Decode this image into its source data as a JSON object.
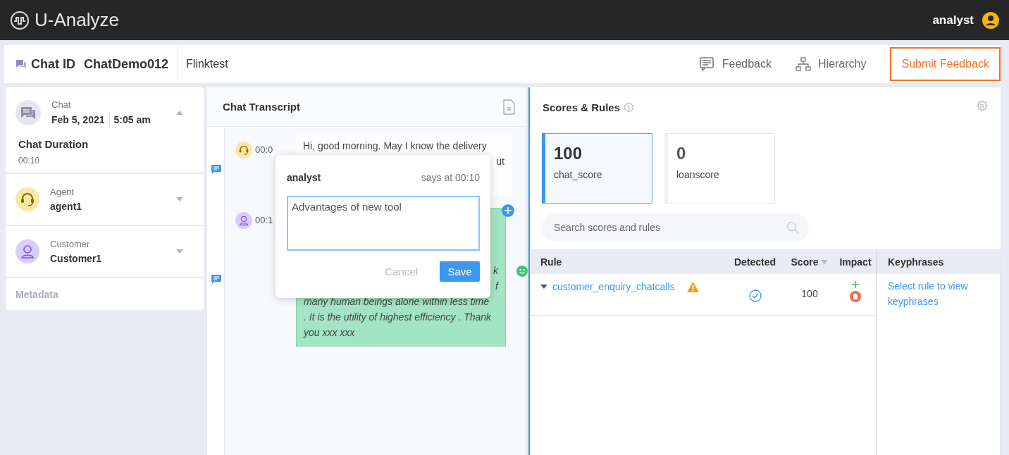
{
  "app": {
    "title": "U-Analyze",
    "user": "analyst"
  },
  "header": {
    "chat_id_label": "Chat ID",
    "chat_id": "ChatDemo012",
    "tag": "Flinktest",
    "actions": [
      {
        "label": "Feedback",
        "kind": "feedback"
      },
      {
        "label": "Hierarchy",
        "kind": "hierarchy"
      }
    ],
    "submit": "Submit Feedback"
  },
  "sidebar": {
    "chat": {
      "label": "Chat",
      "date": "Feb 5, 2021",
      "time": "5:05 am",
      "expanded": true,
      "duration_label": "Chat Duration",
      "duration": "00:10"
    },
    "participants": [
      {
        "kind": "agent",
        "role": "Agent",
        "name": "agent1",
        "expanded": false
      },
      {
        "kind": "customer",
        "role": "Customer",
        "name": "Customer1",
        "expanded": false
      }
    ],
    "metadata": {
      "label": "Metadata",
      "disabled": true
    }
  },
  "transcript": {
    "title": "Chat Transcript",
    "messages": [
      {
        "kind": "agent",
        "time": "00:0",
        "lines": [
          {
            "text": "Hi, good morning. May I know the delivery",
            "kind": "full"
          },
          {
            "text": "ut",
            "kind": "tail"
          }
        ]
      },
      {
        "kind": "customer",
        "time": "00:1",
        "lines": [
          {
            "text": "k",
            "kind": "tail"
          },
          {
            "text": "f",
            "kind": "tail"
          },
          {
            "text": "many human beings alone within less time",
            "kind": "full"
          },
          {
            "text": ". It is the utility of highest efficiency . Thank",
            "kind": "full"
          },
          {
            "text": "you xxx xxx",
            "kind": "full"
          }
        ]
      }
    ],
    "comment": {
      "author": "analyst",
      "meta": "says at 00:10",
      "value": "Advantages of new tool",
      "cancel": "Cancel",
      "save": "Save"
    }
  },
  "scores": {
    "title": "Scores & Rules",
    "cards": [
      {
        "value": "100",
        "name": "chat_score",
        "selected": true
      },
      {
        "value": "0",
        "name": "loanscore",
        "selected": false
      }
    ],
    "search": {
      "placeholder": "Search scores and rules"
    },
    "columns": [
      "Rule",
      "Detected",
      "Score",
      "Impact"
    ],
    "rows": [
      {
        "rule": "customer_enquiry_chatcalls",
        "warning": true,
        "detected": true,
        "score": "100"
      }
    ],
    "keyphrases": {
      "title": "Keyphrases",
      "hint": "Select rule to view keyphrases"
    }
  }
}
